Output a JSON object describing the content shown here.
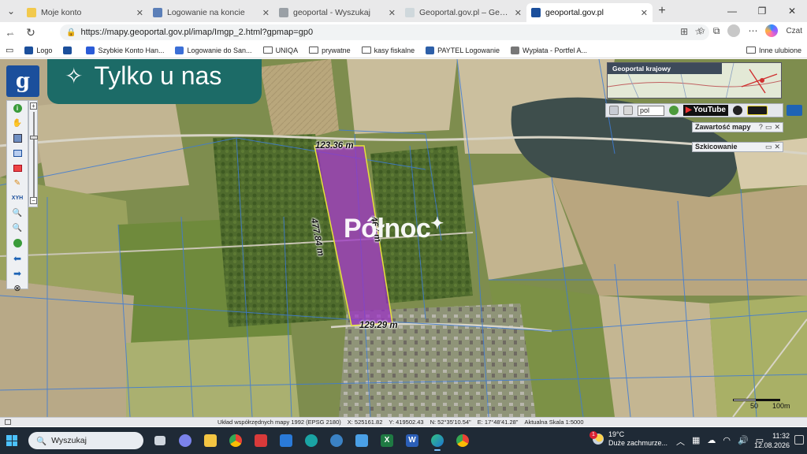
{
  "browser": {
    "tabs": [
      {
        "label": "Moje konto",
        "color": "#f2c94c"
      },
      {
        "label": "Logowanie na koncie",
        "color": "#5b7fb8"
      },
      {
        "label": "geoportal - Wyszukaj",
        "color": "#9aa0a6"
      },
      {
        "label": "Geoportal.gov.pl – Geoportal Infra",
        "color": "#cfd8dc"
      },
      {
        "label": "geoportal.gov.pl",
        "color": "#1b4f9c",
        "active": true
      }
    ],
    "url": "https://mapy.geoportal.gov.pl/imap/Imgp_2.html?gpmap=gp0",
    "copilot_label": "Czat",
    "bookmarks": [
      {
        "label": "Logo",
        "color": "#1b4f9c"
      },
      {
        "label": "",
        "color": "#1b4f9c"
      },
      {
        "label": "Szybkie Konto Han...",
        "color": "#2a5bd7"
      },
      {
        "label": "Logowanie do San...",
        "color": "#3b6fd6"
      },
      {
        "label": "UNIQA",
        "folder": true
      },
      {
        "label": "prywatne",
        "folder": true
      },
      {
        "label": "kasy fiskalne",
        "folder": true
      },
      {
        "label": "PAYTEL Logowanie",
        "color": "#2d5fa8"
      },
      {
        "label": "Wypłata - Portfel A...",
        "color": "#777777"
      },
      {
        "label": "Inne ulubione",
        "folder": true
      }
    ]
  },
  "geoportal": {
    "logo_letter": "g",
    "promo_text": "Tylko u nas",
    "watermark": "Północ",
    "dimensions": {
      "top": "123.36 m",
      "left": "477.84 m",
      "right": "467 m",
      "bottom": "129.29 m"
    },
    "overview_title": "Geoportal krajowy",
    "language": "pol",
    "youtube_label": "YouTube",
    "panel_content": "Zawartość mapy",
    "panel_sketch": "Szkicowanie",
    "scale_labels": [
      "50",
      "100m"
    ],
    "status": {
      "system": "Układ współrzędnych mapy 1992 (EPSG 2180)",
      "x": "X: 525161.82",
      "y": "Y: 419502.43",
      "n": "N: 52°35'10.54\"",
      "e": "E: 17°48'41.28\"",
      "scale": "Aktualna Skala 1:5000"
    }
  },
  "taskbar": {
    "search_label": "Wyszukaj",
    "weather_temp": "19°C",
    "weather_desc": "Duże zachmurze...",
    "weather_badge": "1",
    "time": "11:32",
    "date": "12.08.2026"
  }
}
